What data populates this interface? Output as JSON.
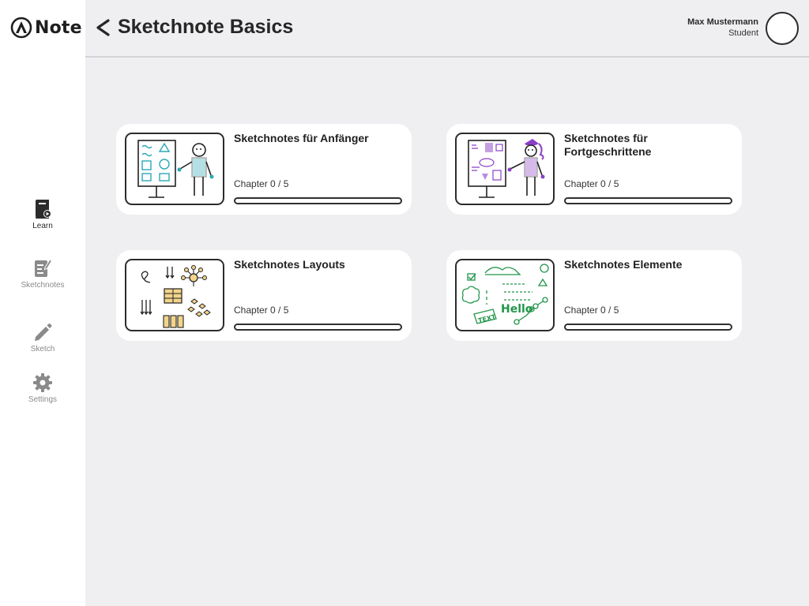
{
  "app": {
    "name": "Note",
    "logo_icon": "app-logo-icon"
  },
  "sidebar": {
    "items": [
      {
        "label": "Learn",
        "icon": "learn-book-icon",
        "active": true
      },
      {
        "label": "Sketchnotes",
        "icon": "sketchnotes-icon",
        "active": false
      },
      {
        "label": "Sketch",
        "icon": "pencil-icon",
        "active": false
      },
      {
        "label": "Settings",
        "icon": "gear-icon",
        "active": false
      }
    ]
  },
  "header": {
    "back_icon": "chevron-left-icon",
    "title": "Sketchnote Basics",
    "user": {
      "name": "Max Mustermann",
      "role": "Student"
    }
  },
  "courses": [
    {
      "title": "Sketchnotes für Anfänger",
      "chapter": "Chapter 0 / 5",
      "progress": 0,
      "accent": "#2aa8b6"
    },
    {
      "title": "Sketchnotes für Fortgeschrittene",
      "chapter": "Chapter 0 / 5",
      "progress": 0,
      "accent": "#8b3fc6"
    },
    {
      "title": "Sketchnotes Layouts",
      "chapter": "Chapter 0 / 5",
      "progress": 0,
      "accent": "#e0b43a"
    },
    {
      "title": "Sketchnotes Elemente",
      "chapter": "Chapter 0 / 5",
      "progress": 0,
      "accent": "#22954a"
    }
  ],
  "colors": {
    "background": "#efeff2",
    "sidebar": "#ffffff",
    "card": "#ffffff",
    "text": "#222222"
  }
}
